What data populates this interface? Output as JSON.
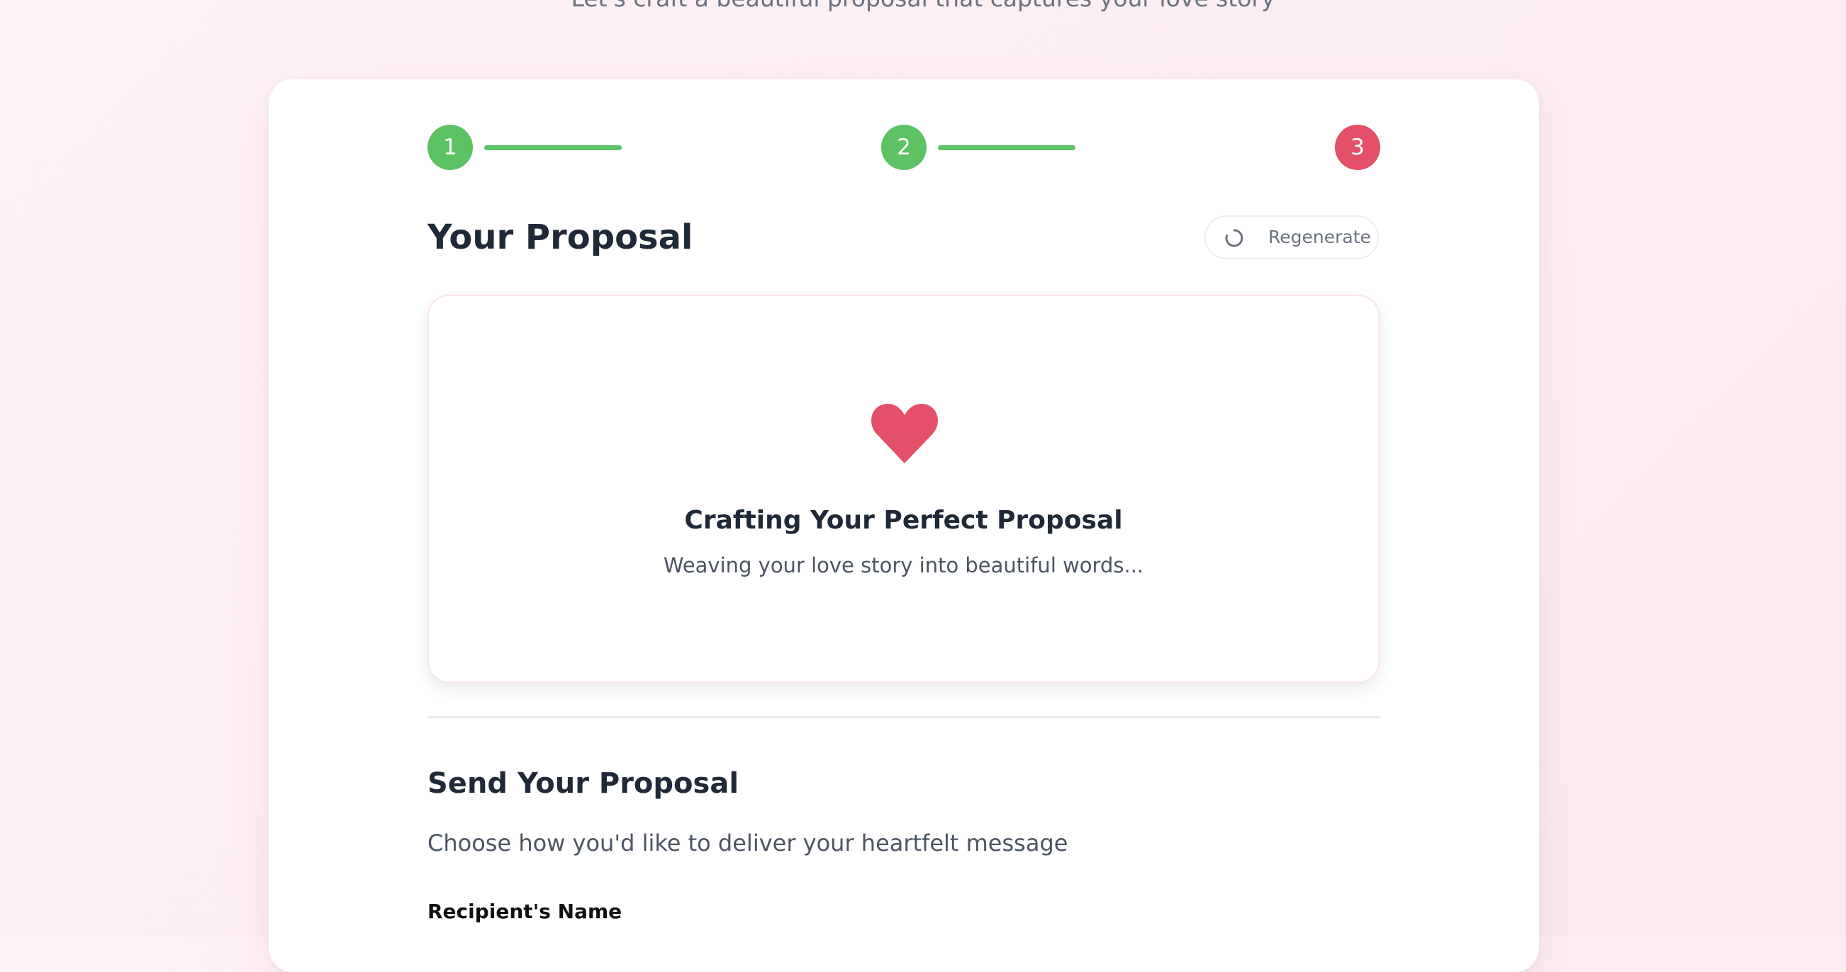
{
  "page": {
    "tagline": "Let's craft a beautiful proposal that captures your love story"
  },
  "stepper": {
    "steps": [
      {
        "number": "1",
        "status": "completed"
      },
      {
        "number": "2",
        "status": "completed"
      },
      {
        "number": "3",
        "status": "current"
      }
    ],
    "colors": {
      "completed": "#5cc264",
      "current": "#e35068"
    }
  },
  "proposal": {
    "title": "Your Proposal",
    "regenerate_label": "Regenerate",
    "regenerate_icon": "loading-spinner-icon",
    "loading": {
      "icon": "heart-icon",
      "title": "Crafting Your Perfect Proposal",
      "subtitle": "Weaving your love story into beautiful words..."
    }
  },
  "send": {
    "title": "Send Your Proposal",
    "subtitle": "Choose how you'd like to deliver your heartfelt message",
    "recipient_label": "Recipient's Name"
  },
  "colors": {
    "accent": "#e35068",
    "success": "#5cc264",
    "text_primary": "#1f2937",
    "text_secondary": "#4b5563"
  }
}
